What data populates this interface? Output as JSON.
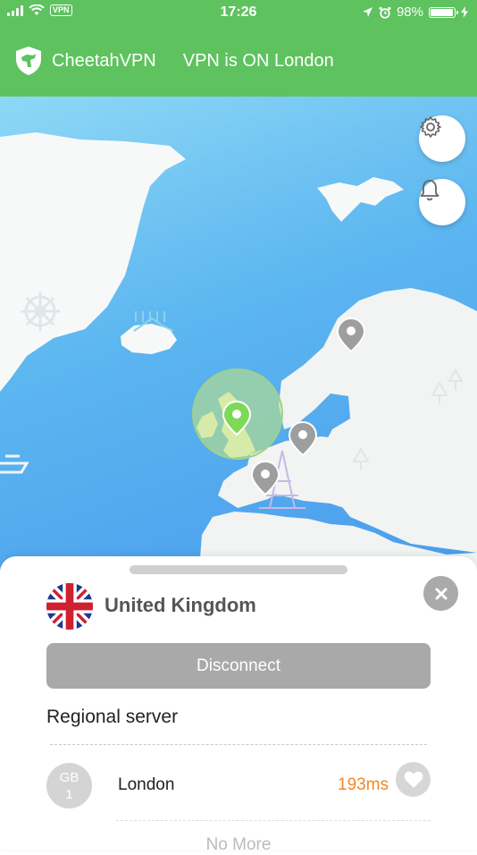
{
  "status_bar": {
    "time": "17:26",
    "vpn_badge": "VPN",
    "battery": "98%",
    "battery_level": 0.98
  },
  "header": {
    "app_name": "CheetahVPN",
    "status": "VPN is ON London"
  },
  "map": {
    "settings_icon": "gear-icon",
    "notifications_icon": "bell-icon",
    "connected_pin_color": "#7ed957",
    "inactive_pin_color": "#9e9e9e"
  },
  "panel": {
    "country": "United Kingdom",
    "disconnect_label": "Disconnect",
    "section_title": "Regional server",
    "servers": [
      {
        "badge_line1": "GB",
        "badge_line2": "1",
        "city": "London",
        "ping": "193ms"
      }
    ],
    "end_text": "No More"
  },
  "colors": {
    "header_green": "#5ec25f",
    "ping_orange": "#f0892a",
    "button_gray": "#a9a9a9"
  }
}
